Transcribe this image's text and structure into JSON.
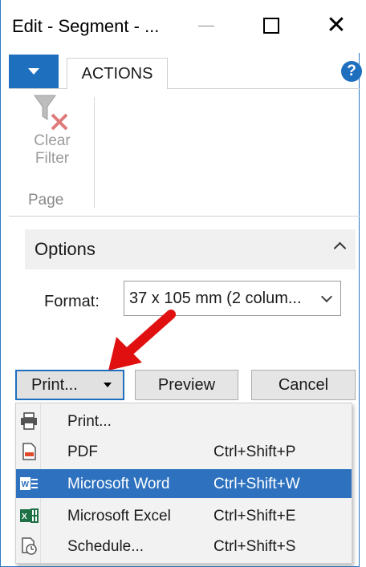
{
  "window": {
    "title": "Edit - Segment - ..."
  },
  "ribbon": {
    "tab_label": "ACTIONS",
    "help_label": "?",
    "clear_filter_line1": "Clear",
    "clear_filter_line2": "Filter",
    "group_label": "Page"
  },
  "options": {
    "header": "Options",
    "format_label": "Format:",
    "format_value": "37 x 105 mm (2 colum..."
  },
  "buttons": {
    "print": "Print...",
    "preview": "Preview",
    "cancel": "Cancel"
  },
  "menu": {
    "items": [
      {
        "label": "Print...",
        "shortcut": "",
        "icon": "printer-icon"
      },
      {
        "label": "PDF",
        "shortcut": "Ctrl+Shift+P",
        "icon": "pdf-icon"
      },
      {
        "label": "Microsoft Word",
        "shortcut": "Ctrl+Shift+W",
        "icon": "word-icon"
      },
      {
        "label": "Microsoft Excel",
        "shortcut": "Ctrl+Shift+E",
        "icon": "excel-icon"
      },
      {
        "label": "Schedule...",
        "shortcut": "Ctrl+Shift+S",
        "icon": "schedule-icon"
      }
    ],
    "selected_index": 2
  },
  "colors": {
    "accent": "#1f6fbf",
    "selected": "#2e72bf",
    "arrow": "#e01010"
  }
}
